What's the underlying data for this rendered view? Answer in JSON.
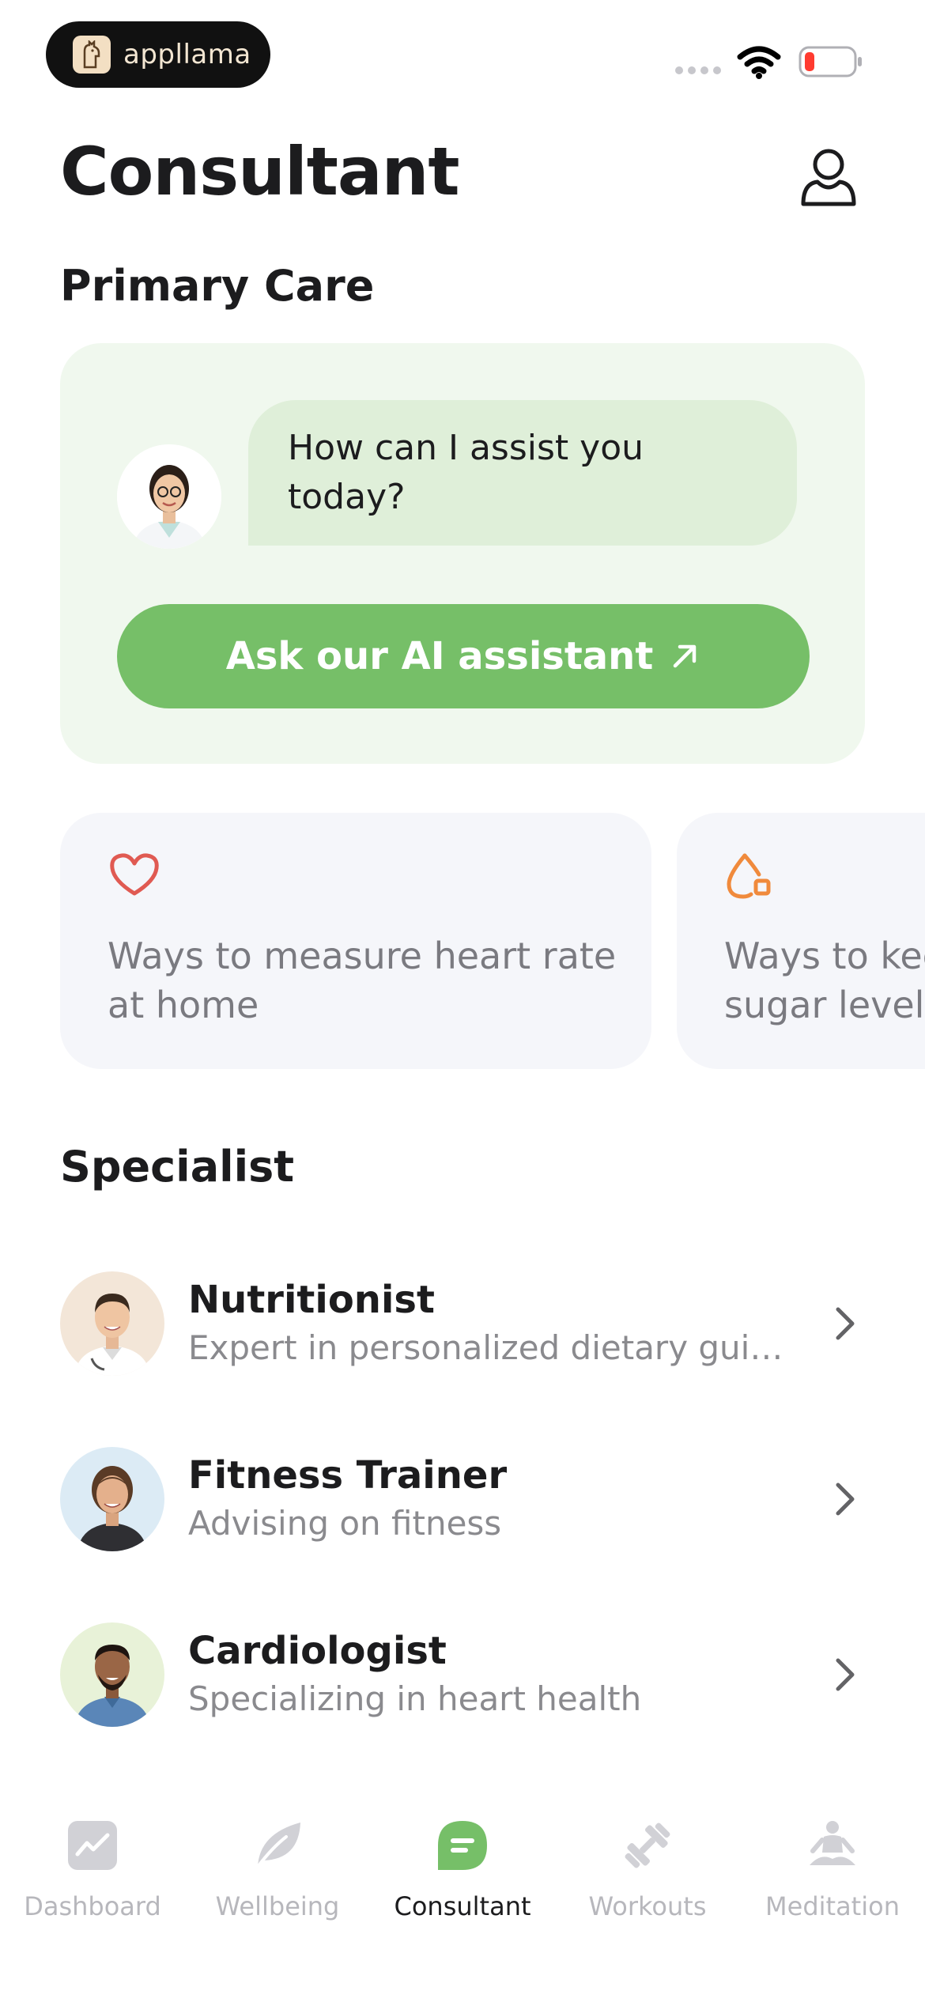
{
  "status_bar": {
    "brand": "appllama"
  },
  "header": {
    "title": "Consultant"
  },
  "primary_care": {
    "section_title": "Primary Care",
    "greeting": "How can I assist you today?",
    "cta_label": "Ask our AI assistant"
  },
  "tips": [
    {
      "icon": "heart-icon",
      "color": "#e05a52",
      "text_line1": "Ways to measure heart rate",
      "text_line2": "at home"
    },
    {
      "icon": "blood-drop-icon",
      "color": "#f08a3c",
      "text_line1": "Ways to keep",
      "text_line2": "sugar levels"
    }
  ],
  "specialist": {
    "section_title": "Specialist",
    "items": [
      {
        "name": "Nutritionist",
        "description": "Expert in personalized dietary guida…",
        "avatar_bg": "#f3e6d8"
      },
      {
        "name": "Fitness Trainer",
        "description": "Advising on fitness",
        "avatar_bg": "#dcebf5"
      },
      {
        "name": "Cardiologist",
        "description": "Specializing in heart health",
        "avatar_bg": "#e8f2d8"
      }
    ]
  },
  "tab_bar": {
    "active": "Consultant",
    "tabs": [
      {
        "label": "Dashboard",
        "icon": "dashboard-icon"
      },
      {
        "label": "Wellbeing",
        "icon": "leaf-icon"
      },
      {
        "label": "Consultant",
        "icon": "chat-icon"
      },
      {
        "label": "Workouts",
        "icon": "dumbbell-icon"
      },
      {
        "label": "Meditation",
        "icon": "meditation-icon"
      }
    ]
  },
  "colors": {
    "accent_green": "#76bf68",
    "card_green_bg": "#f0f8ee",
    "bubble_green": "#dfefd9",
    "tab_inactive": "#b7b7bc",
    "battery_low": "#ff3b30"
  }
}
